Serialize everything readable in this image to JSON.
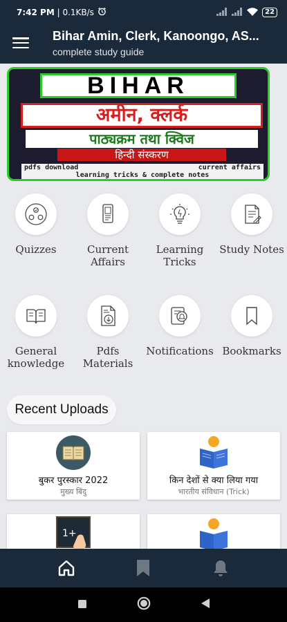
{
  "status_bar": {
    "time": "7:42 PM",
    "speed": "0.1KB/s",
    "battery": "22"
  },
  "app_bar": {
    "title": "Bihar Amin, Clerk, Kanoongo, AS...",
    "subtitle": "complete study guide"
  },
  "banner": {
    "line1": "BIHAR",
    "line2": "अमीन, क्लर्क",
    "line3": "पाठ्यक्रम तथा क्विज",
    "line4": "हिन्दी संस्करण",
    "line5a_left": "pdfs download",
    "line5a_right": "current affairs",
    "line5b": "learning tricks & complete notes"
  },
  "grid": [
    {
      "label1": "Quizzes",
      "label2": "",
      "icon": "quiz-icon"
    },
    {
      "label1": "Current",
      "label2": "Affairs",
      "icon": "current-affairs-icon"
    },
    {
      "label1": "Learning",
      "label2": "Tricks",
      "icon": "lightbulb-icon"
    },
    {
      "label1": "Study Notes",
      "label2": "",
      "icon": "study-notes-icon"
    },
    {
      "label1": "General",
      "label2": "knowledge",
      "icon": "book-open-icon"
    },
    {
      "label1": "Pdfs",
      "label2": "Materials",
      "icon": "pdf-download-icon"
    },
    {
      "label1": "Notifications",
      "label2": "",
      "icon": "notifications-icon"
    },
    {
      "label1": "Bookmarks",
      "label2": "",
      "icon": "bookmark-icon"
    }
  ],
  "recent": {
    "heading": "Recent Uploads",
    "cards": [
      {
        "title": "बुकर पुरस्कार 2022",
        "subtitle": "मुख्य बिंदु",
        "thumb": "book-thumb-icon"
      },
      {
        "title": "किन देशों से क्या लिया गया",
        "subtitle": "भारतीय संविधान (Trick)",
        "thumb": "reader-thumb-icon"
      },
      {
        "title": "",
        "subtitle": "",
        "thumb": "blackboard-thumb-icon"
      },
      {
        "title": "",
        "subtitle": "",
        "thumb": "reader-thumb-icon"
      }
    ]
  },
  "bottom_nav": [
    "home-icon",
    "bookmark-icon",
    "notifications-icon"
  ],
  "colors": {
    "bar": "#1b2a3a",
    "background": "#e9eaee",
    "banner_green": "#29cc29",
    "banner_red": "#d61f1f"
  }
}
